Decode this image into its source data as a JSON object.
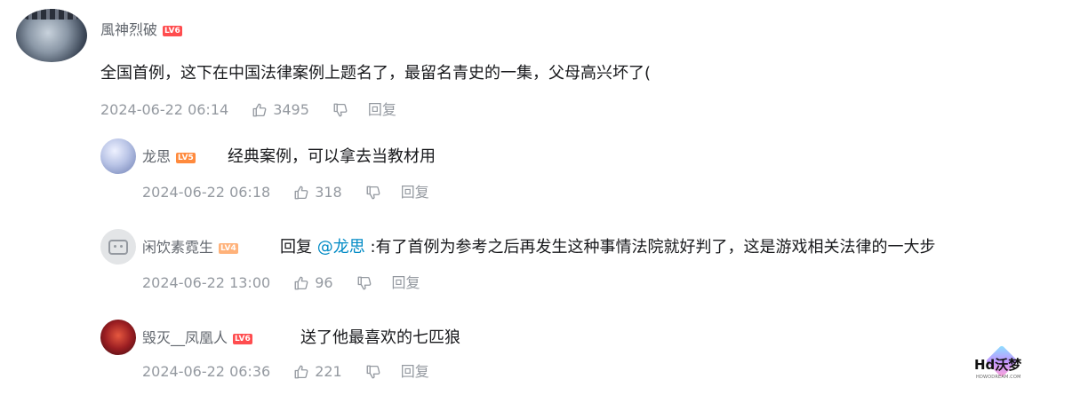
{
  "comments": [
    {
      "username": "風神烈破",
      "level": "LV6",
      "content": "全国首例，这下在中国法律案例上题名了，最留名青史的一集，父母高兴坏了(",
      "time": "2024-06-22 06:14",
      "likes": "3495",
      "reply_label": "回复"
    }
  ],
  "replies": [
    {
      "username": "龙思",
      "level": "LV5",
      "content": "经典案例，可以拿去当教材用",
      "time": "2024-06-22 06:18",
      "likes": "318",
      "reply_label": "回复"
    },
    {
      "username": "闲饮素霓生",
      "level": "LV4",
      "reply_prefix": "回复",
      "mention": "@龙思",
      "content": ":有了首例为参考之后再发生这种事情法院就好判了，这是游戏相关法律的一大步",
      "time": "2024-06-22 13:00",
      "likes": "96",
      "reply_label": "回复"
    },
    {
      "username": "毁灭__凤凰人",
      "level": "LV6",
      "content": "送了他最喜欢的七匹狼",
      "time": "2024-06-22 06:36",
      "likes": "221",
      "reply_label": "回复"
    }
  ],
  "watermark": {
    "text": "Hd沃梦",
    "sub": "HDWODREAM.COM"
  },
  "colors": {
    "level6": "#ff4d4f",
    "level5": "#ff8a3d",
    "level4": "#ffb27a",
    "mention": "#008ac5",
    "meta": "#9499a0"
  }
}
